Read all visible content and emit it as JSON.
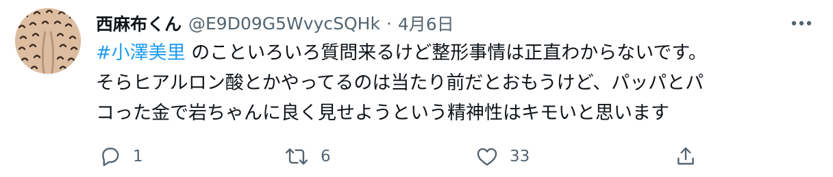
{
  "tweet": {
    "display_name": "西麻布くん",
    "handle": "@E9D09G5WvycSQHk",
    "separator": "·",
    "date": "4月6日",
    "hashtag": "#小澤美里",
    "body_line1_rest": " のこといろいろ質問来るけど整形事情は正直わからないです。",
    "body_line2": "そらヒアルロン酸とかやってるのは当たり前だとおもうけど、パッパとパ",
    "body_line3": "コった金で岩ちゃんに良く見せようという精神性はキモいと思います"
  },
  "actions": {
    "reply_count": "1",
    "retweet_count": "6",
    "like_count": "33"
  },
  "icons": {
    "more": "more-horizontal-icon",
    "reply": "reply-icon",
    "retweet": "retweet-icon",
    "like": "heart-icon",
    "share": "share-icon"
  },
  "colors": {
    "hashtag": "#1d9bf0",
    "secondary_text": "#536471",
    "primary_text": "#0f1419"
  }
}
